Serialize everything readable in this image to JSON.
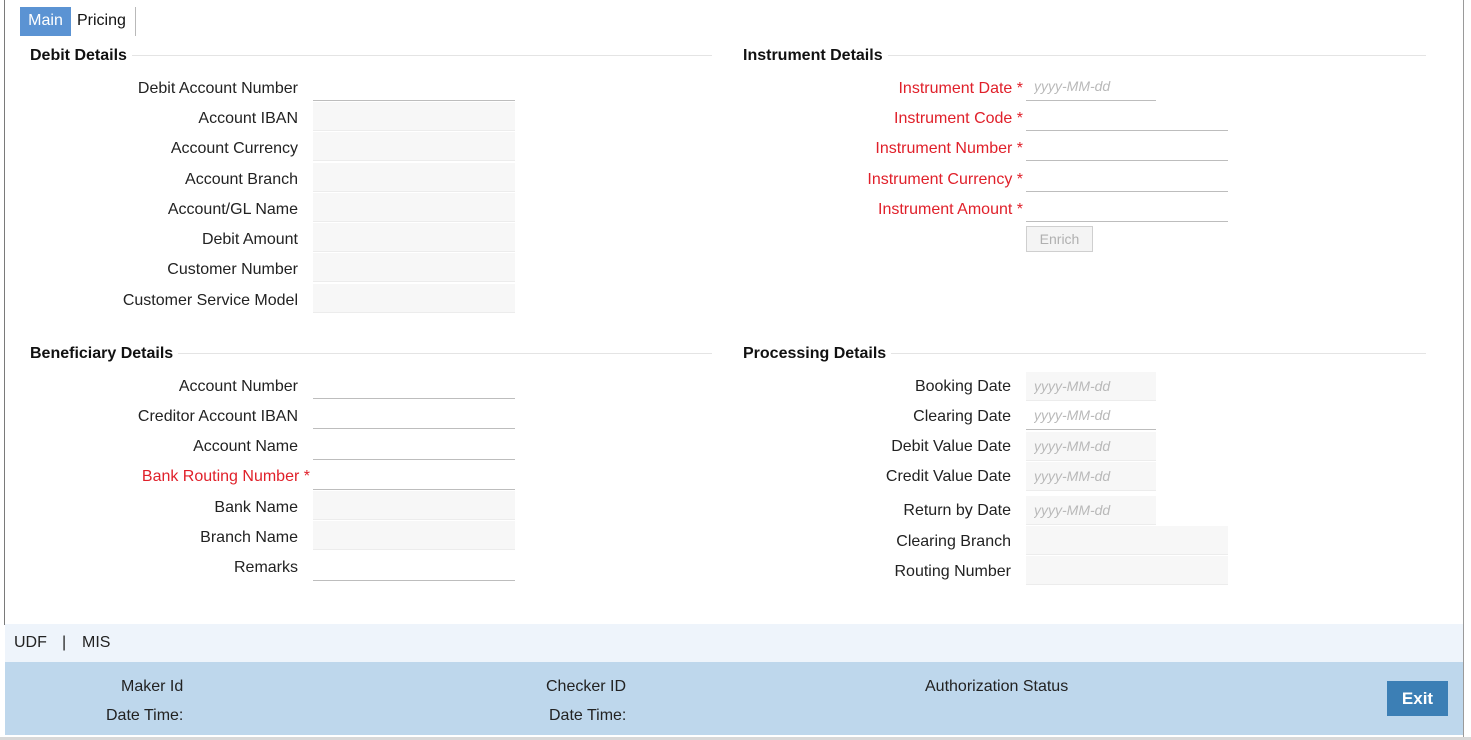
{
  "tabs": [
    "Main",
    "Pricing"
  ],
  "debit": {
    "title": "Debit Details",
    "rows": [
      {
        "label": "Debit Account Number",
        "editable": true
      },
      {
        "label": "Account IBAN",
        "editable": false
      },
      {
        "label": "Account Currency",
        "editable": false
      },
      {
        "label": "Account Branch",
        "editable": false
      },
      {
        "label": "Account/GL Name",
        "editable": false
      },
      {
        "label": "Debit Amount",
        "editable": false
      },
      {
        "label": "Customer Number",
        "editable": false
      },
      {
        "label": "Customer Service Model",
        "editable": false
      }
    ]
  },
  "instrument": {
    "title": "Instrument Details",
    "rows": [
      {
        "label": "Instrument Date",
        "required": true,
        "placeholder": "yyyy-MM-dd"
      },
      {
        "label": "Instrument Code",
        "required": true,
        "placeholder": ""
      },
      {
        "label": "Instrument Number",
        "required": true,
        "placeholder": ""
      },
      {
        "label": "Instrument Currency",
        "required": true,
        "placeholder": ""
      },
      {
        "label": "Instrument Amount",
        "required": true,
        "placeholder": ""
      }
    ],
    "enrich_label": "Enrich"
  },
  "beneficiary": {
    "title": "Beneficiary Details",
    "rows": [
      {
        "label": "Account Number",
        "editable": true
      },
      {
        "label": "Creditor Account IBAN",
        "editable": true
      },
      {
        "label": "Account Name",
        "editable": true
      },
      {
        "label": "Bank Routing Number",
        "editable": true,
        "required": true
      },
      {
        "label": "Bank Name",
        "editable": false
      },
      {
        "label": "Branch Name",
        "editable": false
      },
      {
        "label": "Remarks",
        "editable": true
      }
    ]
  },
  "processing": {
    "title": "Processing Details",
    "rows": [
      {
        "label": "Booking Date",
        "placeholder": "yyyy-MM-dd",
        "editable": false
      },
      {
        "label": "Clearing Date",
        "placeholder": "yyyy-MM-dd",
        "editable": true
      },
      {
        "label": "Debit Value Date",
        "placeholder": "yyyy-MM-dd",
        "editable": false
      },
      {
        "label": "Credit Value Date",
        "placeholder": "yyyy-MM-dd",
        "editable": false
      },
      {
        "label": "Return by Date",
        "placeholder": "yyyy-MM-dd",
        "editable": false
      },
      {
        "label": "Clearing Branch",
        "placeholder": "",
        "editable": false
      },
      {
        "label": "Routing Number",
        "placeholder": "",
        "editable": false
      }
    ]
  },
  "links": {
    "udf": "UDF",
    "separator": "|",
    "mis": "MIS"
  },
  "footer": {
    "maker_id": "Maker Id",
    "maker_datetime": "Date Time:",
    "checker_id": "Checker ID",
    "checker_datetime": "Date Time:",
    "auth_status": "Authorization Status",
    "exit_label": "Exit"
  }
}
